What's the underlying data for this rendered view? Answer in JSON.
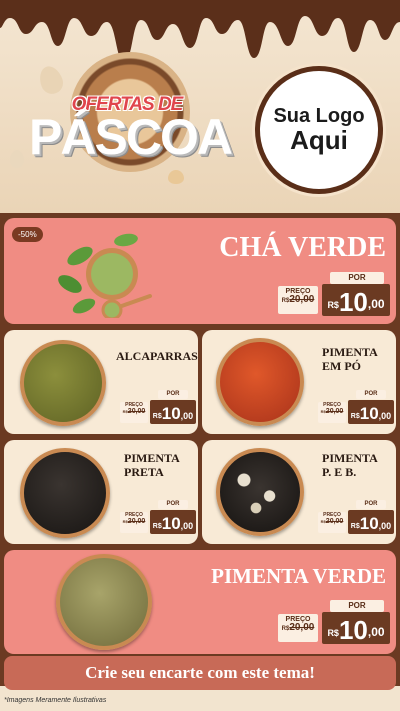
{
  "header": {
    "title_line1": "OFERTAS DE",
    "title_line2": "PÁSCOA",
    "logo_line1": "Sua Logo",
    "logo_line2": "Aqui"
  },
  "price_labels": {
    "preco": "PREÇO",
    "por": "POR",
    "currency": "R$",
    "kg": "KG"
  },
  "featured": {
    "badge": "-50%",
    "name": "CHÁ VERDE",
    "old_price": "20,00",
    "new_int": "10",
    "new_dec": ",00"
  },
  "grid": [
    {
      "name": "ALCAPARRAS",
      "old_price": "20,00",
      "new_int": "10",
      "new_dec": ",00"
    },
    {
      "name": "PIMENTA EM PÓ",
      "old_price": "20,00",
      "new_int": "10",
      "new_dec": ",00"
    },
    {
      "name": "PIMENTA PRETA",
      "old_price": "20,00",
      "new_int": "10",
      "new_dec": ",00"
    },
    {
      "name": "PIMENTA P. E B.",
      "old_price": "20,00",
      "new_int": "10",
      "new_dec": ",00"
    }
  ],
  "bottom": {
    "name": "PIMENTA VERDE",
    "old_price": "20,00",
    "new_int": "10",
    "new_dec": ",00"
  },
  "cta": "Crie seu encarte com este tema!",
  "footnote": "*Imagens Meramente Ilustrativas",
  "colors": {
    "pink": "#f08c83",
    "cream": "#f8ead6",
    "brown": "#6b3a22",
    "cta": "#c86a57"
  }
}
